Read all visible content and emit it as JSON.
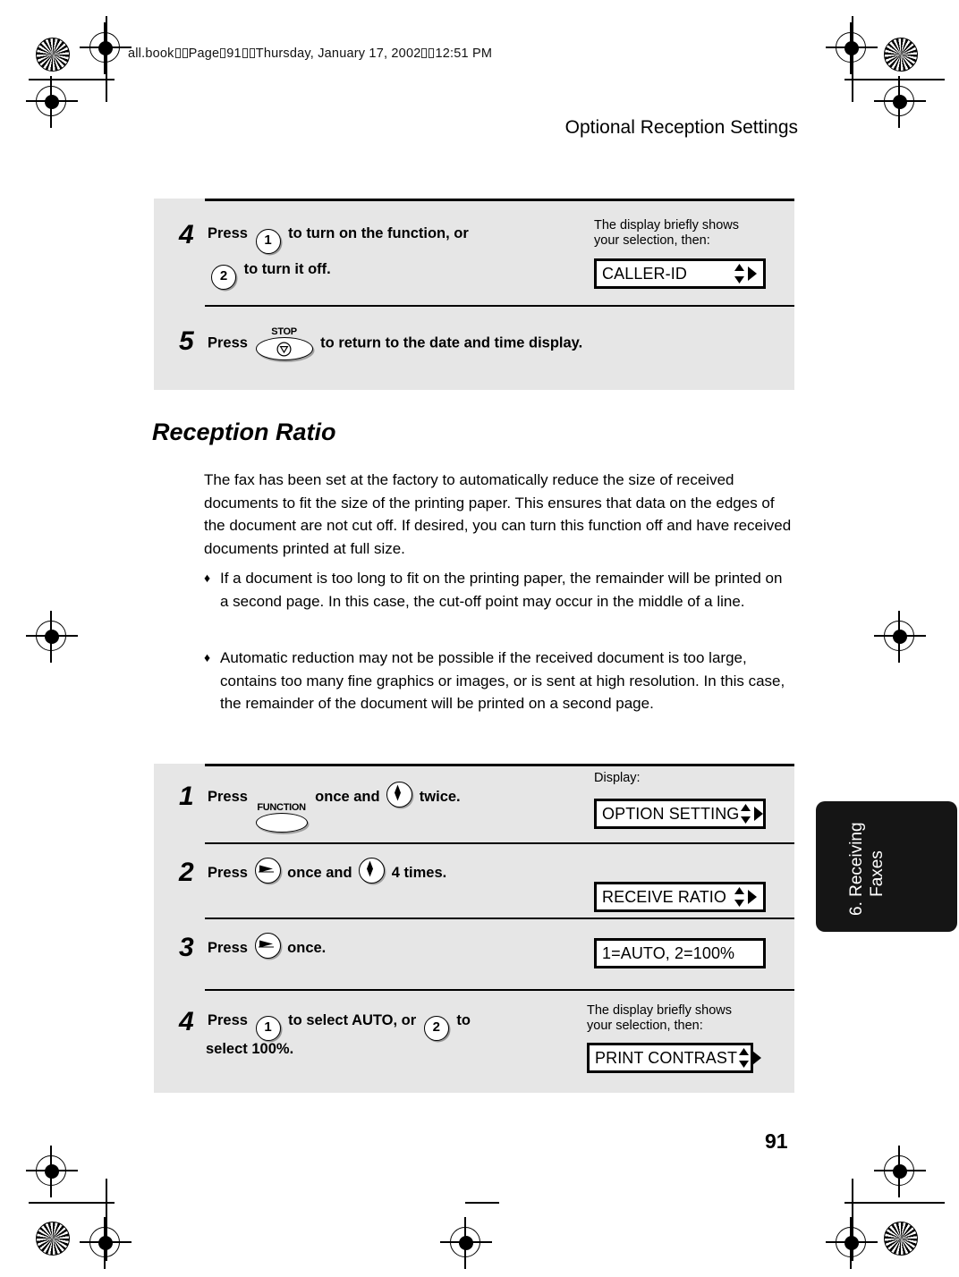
{
  "header": {
    "file_meta_parts": [
      "all.book",
      "Page",
      "91",
      "Thursday, January 17, 2002",
      "12:51 PM"
    ],
    "file_meta": "all.book  Page 91  Thursday, January 17, 2002  12:51 PM",
    "running_head": "Optional Reception Settings"
  },
  "procedure_top": {
    "steps": [
      {
        "number": "4",
        "line1_pre": "Press",
        "key1": "1",
        "line1_mid": "to turn on the function, or",
        "key2": "2",
        "line2": "to turn it off.",
        "callout_caption": "The display briefly shows\nyour selection, then:",
        "lcd_text": "CALLER-ID",
        "lcd_arrows": "updown-right"
      },
      {
        "number": "5",
        "line1_pre": "Press",
        "key_label": "STOP",
        "key_glyph": "stop-triangle",
        "line1_post": "to return to the date and time display."
      }
    ]
  },
  "section": {
    "title": "Reception Ratio",
    "paragraph": "The fax has been set at the factory to automatically reduce the size of received documents to fit the size of the printing paper. This ensures that data on the edges of the document are not cut off. If desired, you can turn this function off and have received documents printed at full size.",
    "bullet_glyph": "♦",
    "bullets": [
      "If a document is too long to fit on the printing paper, the remainder will be printed on a second page. In this case, the cut-off point may occur in the middle of a line.",
      "Automatic reduction may not be possible if the received document is too large, contains too many fine graphics or images, or is sent at high resolution. In this case, the remainder of the document will be printed on a second page."
    ]
  },
  "procedure_bottom": {
    "display_label": "Display:",
    "steps": [
      {
        "number": "1",
        "pre": "Press",
        "key_label": "FUNCTION",
        "mid": "once and",
        "key2_glyph": "updown-round",
        "post": "twice.",
        "lcd_text": "OPTION SETTING",
        "lcd_arrows": "updown-right"
      },
      {
        "number": "2",
        "pre": "Press",
        "key1_glyph": "right-round",
        "mid": "once and",
        "key2_glyph": "updown-round",
        "post": "4 times.",
        "lcd_text": "RECEIVE RATIO",
        "lcd_arrows": "updown-right"
      },
      {
        "number": "3",
        "pre": "Press",
        "key1_glyph": "right-round",
        "post": "once.",
        "lcd_text": "1=AUTO, 2=100%",
        "lcd_arrows": "none"
      },
      {
        "number": "4",
        "pre": "Press",
        "key1": "1",
        "mid": "to select AUTO, or",
        "key2": "2",
        "post": "to",
        "line2": "select 100%.",
        "callout_caption": "The display briefly shows\nyour selection, then:",
        "lcd_text": "PRINT CONTRAST",
        "lcd_arrows": "updown-right"
      }
    ]
  },
  "side_tab": {
    "label": "6. Receiving\n    Faxes"
  },
  "footer": {
    "page_number": "91"
  },
  "colors": {
    "panel_gray": "#e6e6e6",
    "tab_black": "#151515",
    "rule_black": "#000000"
  }
}
